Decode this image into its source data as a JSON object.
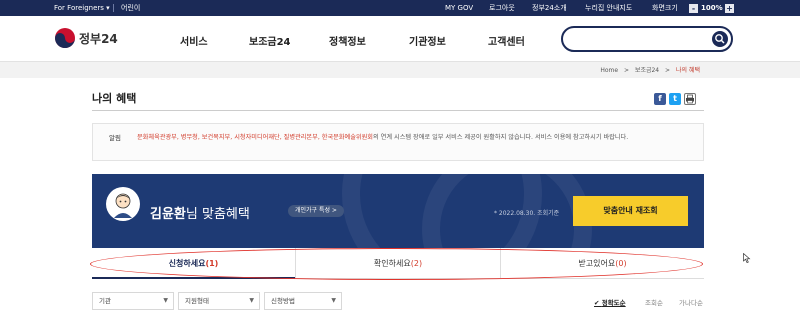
{
  "topbar": {
    "foreigners": "For Foreigners",
    "kids": "어린이",
    "mygov": "MY GOV",
    "logout": "로그아웃",
    "about": "정부24소개",
    "sitemap": "누리집 안내지도",
    "screen_size_label": "화면크기",
    "zoom_minus": "-",
    "zoom_level": "100%",
    "zoom_plus": "+"
  },
  "header": {
    "logo_text": "정부24",
    "nav": [
      "서비스",
      "보조금24",
      "정책정보",
      "기관정보",
      "고객센터"
    ],
    "search_placeholder": "",
    "icons": {
      "logo": "taegeuk-logo-icon",
      "search": "search-icon"
    }
  },
  "breadcrumb": {
    "items": [
      "Home",
      ">",
      "보조금24",
      ">",
      "나의 혜택"
    ]
  },
  "page": {
    "title": "나의 혜택",
    "share_icons": [
      "facebook-icon",
      "twitter-icon",
      "print-icon"
    ]
  },
  "notice": {
    "tag": "알림",
    "highlight": "문화체육관광부, 병무청, 보건복지부, 시청자미디어재단, 질병관리본부, 한국문화예술위원회",
    "text": "의 연계 시스템 장애로 일부 서비스 제공이 원활하지 않습니다. 서비스 이용에 참고하시기 바랍니다."
  },
  "banner": {
    "name": "김윤환",
    "suffix": "님 맞춤혜택",
    "tag": "개인가구 특성 >",
    "date_note": "* 2022.08.30. 조회기준",
    "refresh_button": "맞춤안내 재조회",
    "colors": {
      "background": "#1e3a74",
      "button": "#f7cc2b"
    }
  },
  "tabs": [
    {
      "label": "신청하세요",
      "count": "(1)"
    },
    {
      "label": "확인하세요",
      "count": "(2)"
    },
    {
      "label": "받고있어요",
      "count": "(0)"
    }
  ],
  "filters": {
    "selects": [
      "기관",
      "지원형태",
      "신청방법"
    ],
    "sort": [
      "정확도순",
      "조회순",
      "가나다순"
    ]
  }
}
